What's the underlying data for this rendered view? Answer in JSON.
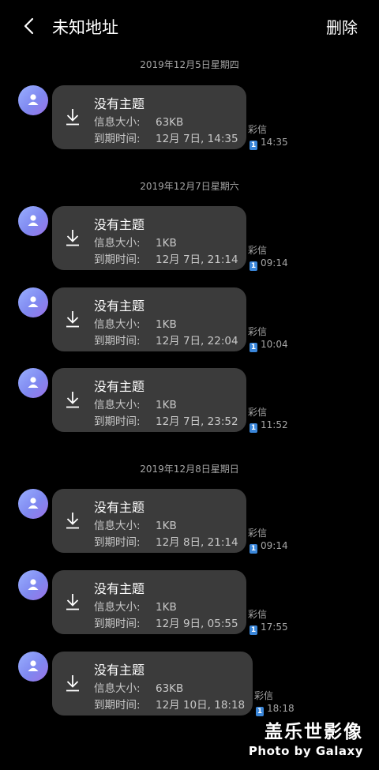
{
  "header": {
    "title": "未知地址",
    "delete_label": "删除"
  },
  "dates": [
    "2019年12月5日星期四",
    "2019年12月7日星期六",
    "2019年12月8日星期日"
  ],
  "labels": {
    "size": "信息大小:",
    "expiry": "到期时间:"
  },
  "messages": [
    {
      "subject": "没有主题",
      "size": "63KB",
      "expiry": "12月 7日, 14:35",
      "type": "彩信",
      "sim": "1",
      "time": "14:35"
    },
    {
      "subject": "没有主题",
      "size": "1KB",
      "expiry": "12月 7日, 21:14",
      "type": "彩信",
      "sim": "1",
      "time": "09:14"
    },
    {
      "subject": "没有主题",
      "size": "1KB",
      "expiry": "12月 7日, 22:04",
      "type": "彩信",
      "sim": "1",
      "time": "10:04"
    },
    {
      "subject": "没有主题",
      "size": "1KB",
      "expiry": "12月 7日, 23:52",
      "type": "彩信",
      "sim": "1",
      "time": "11:52"
    },
    {
      "subject": "没有主题",
      "size": "1KB",
      "expiry": "12月 8日, 21:14",
      "type": "彩信",
      "sim": "1",
      "time": "09:14"
    },
    {
      "subject": "没有主题",
      "size": "1KB",
      "expiry": "12月 9日, 05:55",
      "type": "彩信",
      "sim": "1",
      "time": "17:55"
    },
    {
      "subject": "没有主题",
      "size": "63KB",
      "expiry": "12月 10日, 18:18",
      "type": "彩信",
      "sim": "1",
      "time": "18:18"
    }
  ],
  "watermark": {
    "line1": "盖乐世影像",
    "line2": "Photo by Galaxy"
  }
}
